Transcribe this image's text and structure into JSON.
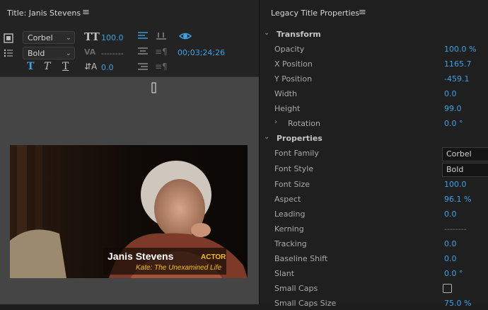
{
  "left": {
    "title": "Title: Janis Stevens",
    "menu_icon": "≡",
    "toolbar": {
      "font_family": "Corbel",
      "font_style": "Bold",
      "font_size": "100.0",
      "kerning": "--------",
      "baseline": "0.0",
      "timecode": "00;03;24;26",
      "format_buttons": [
        "T",
        "T",
        "T"
      ]
    },
    "lower_third": {
      "name": "Janis Stevens",
      "role": "ACTOR",
      "subtitle": "Kate: The Unexamined Life"
    }
  },
  "right": {
    "title": "Legacy Title Properties",
    "menu_icon": "≡",
    "sections": {
      "transform": "Transform",
      "properties": "Properties"
    },
    "rows": [
      {
        "label": "Opacity",
        "value": "100.0 %"
      },
      {
        "label": "X Position",
        "value": "1165.7"
      },
      {
        "label": "Y Position",
        "value": "-459.1"
      },
      {
        "label": "Width",
        "value": "0.0"
      },
      {
        "label": "Height",
        "value": "99.0"
      },
      {
        "label": "Rotation",
        "value": "0.0 °"
      }
    ],
    "prop_rows": [
      {
        "label": "Font Family",
        "value": "Corbel"
      },
      {
        "label": "Font Style",
        "value": "Bold"
      },
      {
        "label": "Font Size",
        "value": "100.0"
      },
      {
        "label": "Aspect",
        "value": "96.1 %"
      },
      {
        "label": "Leading",
        "value": "0.0"
      },
      {
        "label": "Kerning",
        "value": "--------"
      },
      {
        "label": "Tracking",
        "value": "0.0"
      },
      {
        "label": "Baseline Shift",
        "value": "0.0"
      },
      {
        "label": "Slant",
        "value": "0.0 °"
      },
      {
        "label": "Small Caps",
        "value": ""
      },
      {
        "label": "Small Caps Size",
        "value": "75.0 %"
      }
    ]
  },
  "colors": {
    "accent": "#3aa3e8",
    "lower_third_name": "#ffffff",
    "lower_third_role": "#f2c200",
    "lower_third_subtitle": "#f2c200"
  }
}
